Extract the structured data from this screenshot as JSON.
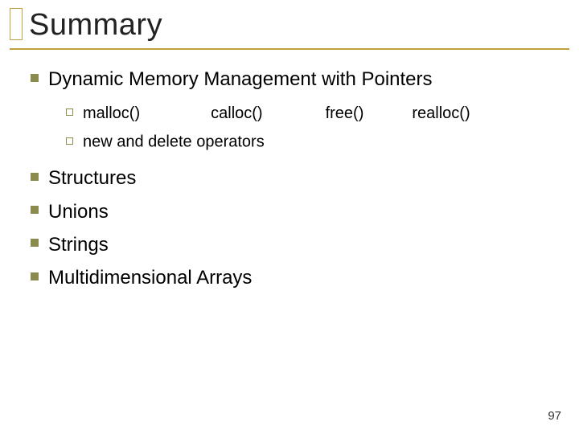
{
  "title": "Summary",
  "items": {
    "i0": {
      "label": "Dynamic Memory Management with Pointers",
      "sub": {
        "s0": {
          "f0": "malloc()",
          "f1": "calloc()",
          "f2": "free()",
          "f3": "realloc()"
        },
        "s1": {
          "text": "new and delete operators"
        }
      }
    },
    "i1": {
      "label": "Structures"
    },
    "i2": {
      "label": "Unions"
    },
    "i3": {
      "label": "Strings"
    },
    "i4": {
      "label": "Multidimensional Arrays"
    }
  },
  "page_number": "97"
}
